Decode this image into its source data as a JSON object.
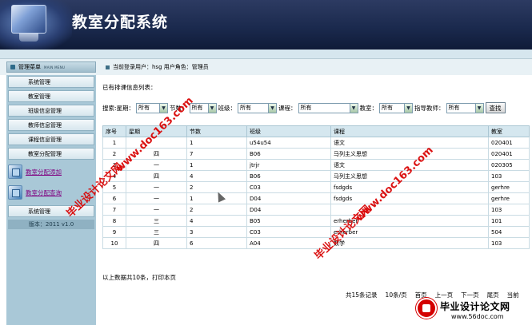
{
  "app": {
    "title": "教室分配系统"
  },
  "menu_header": {
    "title": "管理菜单",
    "subtitle": "MAIN MENU"
  },
  "login": {
    "text": "当前登录用户：hsg  用户角色：管理员"
  },
  "sidebar": {
    "items": [
      "系统管理",
      "教室管理",
      "班级信息管理",
      "教师信息管理",
      "课程信息管理",
      "教室分配管理"
    ],
    "sub_items": [
      "教室分配添加",
      "教室分配查询"
    ],
    "bottom_item": "系统管理",
    "version": "版本：2011 v1.0"
  },
  "main": {
    "list_title": "已有排课信息列表：",
    "search": {
      "prefix": "搜索:星期：",
      "week_value": "所有",
      "period_label": "节数：",
      "period_value": "所有",
      "class_label": "班级：",
      "class_value": "所有",
      "course_label": "课程：",
      "course_value": "所有",
      "room_label": "教室：",
      "room_value": "所有",
      "teacher_label": "指导教师：",
      "teacher_value": "所有",
      "button": "查找"
    },
    "table": {
      "headers": [
        "序号",
        "星期",
        "节数",
        "班级",
        "课程",
        "教室"
      ],
      "rows": [
        [
          "1",
          "",
          "1",
          "u54u54",
          "语文",
          "020401"
        ],
        [
          "2",
          "四",
          "7",
          "B06",
          "马列主义思想",
          "020401"
        ],
        [
          "3",
          "一",
          "1",
          "jtrjr",
          "语文",
          "020305"
        ],
        [
          "4",
          "四",
          "4",
          "B06",
          "马列主义思想",
          "103"
        ],
        [
          "5",
          "一",
          "2",
          "C03",
          "fsdgds",
          "gerhre"
        ],
        [
          "6",
          "一",
          "1",
          "D04",
          "fsdgds",
          "gerhre"
        ],
        [
          "7",
          "一",
          "2",
          "D04",
          "",
          "103"
        ],
        [
          "8",
          "三",
          "4",
          "B05",
          "erherber",
          "101"
        ],
        [
          "9",
          "三",
          "3",
          "C03",
          "erherber",
          "504"
        ],
        [
          "10",
          "四",
          "6",
          "A04",
          "数学",
          "103"
        ]
      ]
    },
    "summary": "以上数据共10条，打印本页",
    "pager": [
      "共15条记录",
      "10条/页",
      "首页",
      "上一页",
      "下一页",
      "尾页",
      "当前"
    ]
  },
  "watermarks": {
    "a": "毕业设计论文网",
    "b": "www.doc163.com",
    "c": "毕业设计论文网",
    "d": "www.doc163.com"
  },
  "logo": {
    "title": "毕业设计论文网",
    "url": "www.56doc.com"
  }
}
